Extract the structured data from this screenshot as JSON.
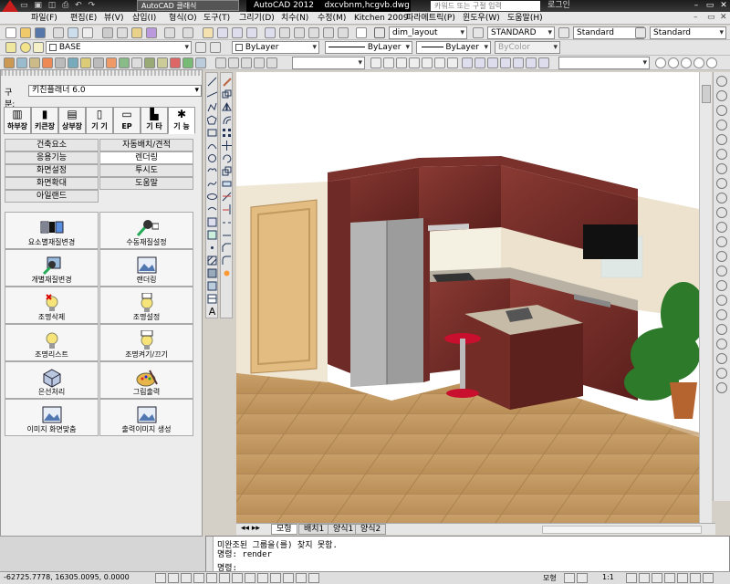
{
  "window": {
    "app_title": "AutoCAD 2012",
    "document": "dxcvbnm,hcgvb.dwg",
    "workspace": "AutoCAD 클래식",
    "search_placeholder": "카워드 또는 구절 입력",
    "login": "로그인"
  },
  "menu": {
    "items": [
      "파일(F)",
      "편집(E)",
      "뷰(V)",
      "삽입(I)",
      "형식(O)",
      "도구(T)",
      "그리기(D)",
      "치수(N)",
      "수정(M)",
      "Kitchen 2009",
      "파라메트릭(P)",
      "윈도우(W)",
      "도움말(H)"
    ]
  },
  "toolbar": {
    "dim_style": "dim_layout",
    "text_style": "STANDARD",
    "table_style": "Standard",
    "multileader_style": "Standard",
    "layer": "BASE",
    "color": "ByLayer",
    "linetype": "ByLayer",
    "lineweight": "ByLayer",
    "plotstyle": "ByColor"
  },
  "palette": {
    "category_label": "구분:",
    "category_value": "키친플래너 6.0",
    "tabs": [
      "하부장",
      "키큰장",
      "상부장",
      "기 기",
      "EP",
      "기 타",
      "기 능"
    ],
    "subitems": [
      {
        "label": "건축요소"
      },
      {
        "label": "자동배치/견적"
      },
      {
        "label": "응용기능"
      },
      {
        "label": "렌더링",
        "selected": true
      },
      {
        "label": "화면설정"
      },
      {
        "label": "투시도"
      },
      {
        "label": "화면확대"
      },
      {
        "label": "도움말"
      },
      {
        "label": "아일랜드"
      }
    ],
    "tools": [
      {
        "label": "요소별재질변경",
        "icon": "material-grid-icon"
      },
      {
        "label": "수동재질설정",
        "icon": "paint-brush-icon"
      },
      {
        "label": "개별재질변경",
        "icon": "brush-square-icon"
      },
      {
        "label": "랜더링",
        "icon": "landscape-icon"
      },
      {
        "label": "조명삭제",
        "icon": "bulb-delete-icon"
      },
      {
        "label": "조명설정",
        "icon": "bulb-ok-icon"
      },
      {
        "label": "조명리스트",
        "icon": "bulb-list-icon"
      },
      {
        "label": "조명켜기/끄기",
        "icon": "bulb-onoff-icon"
      },
      {
        "label": "은선처리",
        "icon": "hide-cube-icon"
      },
      {
        "label": "그림출력",
        "icon": "palette-brush-icon"
      },
      {
        "label": "이미지 화면맞춤",
        "icon": "image-fit-icon"
      },
      {
        "label": "출력이미지 생성",
        "icon": "image-create-icon"
      }
    ]
  },
  "layout_tabs": [
    "모형",
    "배치1",
    "양식1",
    "양식2"
  ],
  "command": {
    "line1": "미완조된 그룹을(를) 찾지 못함.",
    "line2": "명령: render",
    "prompt": "명령:"
  },
  "status": {
    "coordinates": "-62725.7778, 16305.0095, 0.0000",
    "model": "모형",
    "scale": "1:1"
  },
  "colors": {
    "cabinet": "#6e2a26",
    "floor": "#c79a5f",
    "wall": "#efe6d4",
    "title_bar": "#1c1c1c"
  }
}
